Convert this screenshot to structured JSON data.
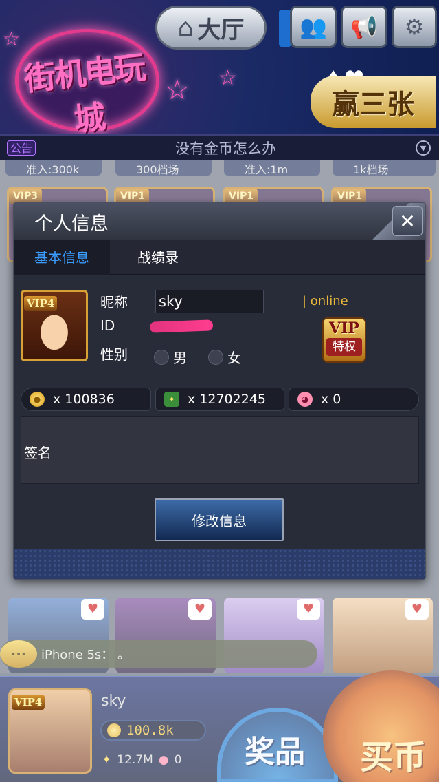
{
  "lobby": {
    "logo_text": "街机电玩城",
    "hall_label": "大厅",
    "game_label": "赢三张",
    "notice": {
      "tag": "公告",
      "text": "没有金币怎么办"
    },
    "room_strips": [
      "准入:300k",
      "300档场",
      "准入:1m",
      "1k档场"
    ],
    "room_vips": [
      "VIP3",
      "VIP1",
      "VIP1",
      "VIP1"
    ],
    "chat_tag": "···",
    "chat": "iPhone 5s： 。"
  },
  "player_bar": {
    "vip": "VIP4",
    "name": "sky",
    "coins": "100.8k",
    "tickets": "12.7M",
    "pigs": "0",
    "prize_label": "奖品",
    "buy_label": "买币"
  },
  "modal": {
    "title": "个人信息",
    "close_symbol": "✕",
    "tabs": [
      {
        "label": "基本信息"
      },
      {
        "label": "战绩录"
      }
    ],
    "profile": {
      "avatar_vip": "VIP4",
      "nickname_label": "昵称",
      "nickname_value": "sky",
      "id_label": "ID",
      "gender_label": "性别",
      "gender_options": [
        "男",
        "女"
      ],
      "status": "| online",
      "vip_badge_top": "VIP",
      "vip_badge_bottom": "特权"
    },
    "currency": [
      {
        "icon": "gold-coin-icon",
        "text": "x 100836"
      },
      {
        "icon": "ticket-icon",
        "text": "x 12702245"
      },
      {
        "icon": "piggy-icon",
        "text": "x 0"
      }
    ],
    "signature_label": "签名",
    "edit_button": "修改信息"
  },
  "colors": {
    "tab_active": "#3a9cff",
    "online": "#e7b63a",
    "modal_bg": "#282b38",
    "button_blue": "#3d6ba8"
  }
}
